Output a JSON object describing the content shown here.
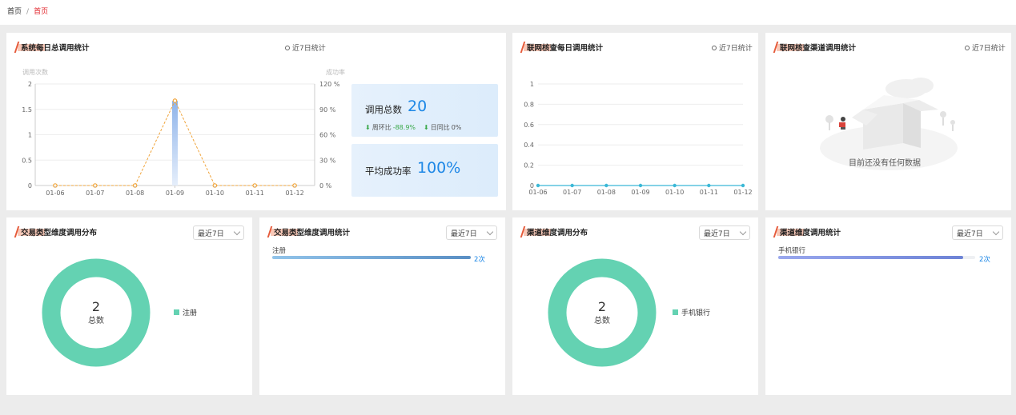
{
  "breadcrumb": {
    "home": "首页",
    "separator": "/",
    "current": "首页"
  },
  "cards": {
    "daily_total": {
      "title": "系统每日总调用统计",
      "period": "近7日统计",
      "stats": {
        "total_label": "调用总数",
        "total_value": "20",
        "wow_label": "周环比",
        "wow_value": "-88.9%",
        "yoy_label": "日同比",
        "yoy_value": "0%",
        "avg_label": "平均成功率",
        "avg_value": "100%"
      }
    },
    "network_daily": {
      "title": "联网核查每日调用统计",
      "period": "近7日统计"
    },
    "network_channel": {
      "title": "联网核查渠道调用统计",
      "period": "近7日统计",
      "empty_text": "目前还没有任何数据"
    },
    "txn_type_dist": {
      "title": "交易类型维度调用分布",
      "select": "最近7日",
      "center_value": "2",
      "center_label": "总数",
      "legend": [
        "注册"
      ]
    },
    "txn_type_stats": {
      "title": "交易类型维度调用统计",
      "select": "最近7日",
      "bars": [
        {
          "label": "注册",
          "value_text": "2次",
          "fraction": 1.0
        }
      ]
    },
    "channel_dist": {
      "title": "渠道维度调用分布",
      "select": "最近7日",
      "center_value": "2",
      "center_label": "总数",
      "legend": [
        "手机银行"
      ]
    },
    "channel_stats": {
      "title": "渠道维度调用统计",
      "select": "最近7日",
      "bars": [
        {
          "label": "手机银行",
          "value_text": "2次",
          "fraction": 0.94
        }
      ]
    }
  },
  "colors": {
    "accent": "#1d87e6",
    "donut": "#64d2b2",
    "line_orange": "#f0a43a",
    "line_teal": "#3bb8d6",
    "title_mark": "#e55a3a",
    "breadcrumb_active": "#e2262c"
  },
  "icons": {
    "period": "circle-outline-icon",
    "select": "chevron-down-icon",
    "up_down": "arrow-down-icon"
  },
  "chart_data": [
    {
      "type": "line",
      "categories": [
        "01-06",
        "01-07",
        "01-08",
        "01-09",
        "01-10",
        "01-11",
        "01-12"
      ],
      "series": [
        {
          "values": [
            0,
            0,
            0,
            1.67,
            0,
            0,
            0
          ],
          "axis": "left"
        },
        {
          "values": [
            0,
            0,
            0,
            100,
            0,
            0,
            0
          ],
          "axis": "right",
          "kind": "bar"
        }
      ],
      "ylabel": "调用次数",
      "ylabel_right": "成功率",
      "ylim": [
        0,
        2
      ],
      "yticks": [
        "0",
        "0.5",
        "1",
        "1.5",
        "2"
      ],
      "ylim_right": [
        0,
        120
      ],
      "yticks_right": [
        "0 %",
        "30 %",
        "60 %",
        "90 %",
        "120 %"
      ],
      "grid": true
    },
    {
      "type": "line",
      "categories": [
        "01-06",
        "01-07",
        "01-08",
        "01-09",
        "01-10",
        "01-11",
        "01-12"
      ],
      "series": [
        {
          "values": [
            0,
            0,
            0,
            0,
            0,
            0,
            0
          ]
        }
      ],
      "ylim": [
        0,
        1
      ],
      "yticks": [
        "0",
        "0.2",
        "0.4",
        "0.6",
        "0.8",
        "1"
      ],
      "grid": true
    },
    {
      "type": "pie",
      "labels": [
        "注册"
      ],
      "values": [
        2
      ]
    },
    {
      "type": "pie",
      "labels": [
        "手机银行"
      ],
      "values": [
        2
      ]
    }
  ]
}
